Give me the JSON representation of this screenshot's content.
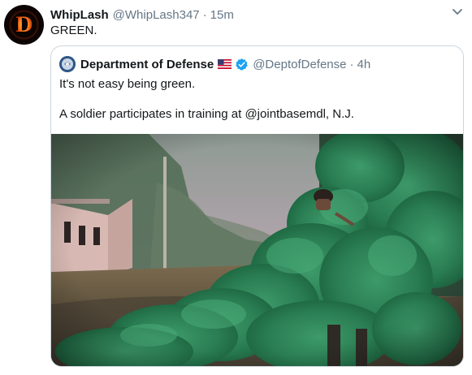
{
  "tweet": {
    "display_name": "WhipLash",
    "handle": "@WhipLash347",
    "separator": "·",
    "time": "15m",
    "text": "GREEN.",
    "avatar_letter": "D"
  },
  "quoted": {
    "display_name": "Department of Defense",
    "handle": "@DeptofDefense",
    "separator": "·",
    "time": "4h",
    "line1": "It's not easy being green.",
    "line2": "A soldier participates in training at @jointbasemdl, N.J.",
    "flag_icon": "us-flag-icon",
    "verified_icon": "verified-badge-icon",
    "image_icon": "green-smoke-soldier-photo"
  },
  "colors": {
    "text": "#14171a",
    "secondary": "#657786",
    "border": "#ccd6dd",
    "verified": "#1da1f2",
    "smoke": "#2e8a5a"
  }
}
